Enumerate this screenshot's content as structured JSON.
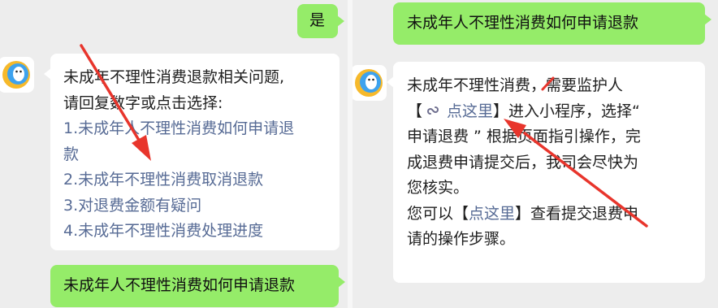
{
  "left_panel": {
    "top_user_bubble": "是",
    "bot_message": {
      "intro_line1": "未成年不理性消费退款相关问题,",
      "intro_line2": "请回复数字或点击选择:",
      "option1_line1": "1.未成年人不理性消费如何申请退",
      "option1_line2": "款",
      "option2": "2.未成年不理性消费取消退款",
      "option3": "3.对退费金额有疑问",
      "option4": "4.未成年不理性消费处理进度"
    },
    "bottom_user_bubble": "未成年人不理性消费如何申请退款"
  },
  "right_panel": {
    "top_user_bubble": "未成年人不理性消费如何申请退款",
    "bot_message": {
      "line1": "未成年不理性消费，需要监护人",
      "line2_open_bracket": "【",
      "line2_link": "点这里",
      "line2_rest": "】进入小程序，选择“",
      "line3": "申请退费 ” 根据页面指引操作，完",
      "line4": "成退费申请提交后，我司会尽快为",
      "line5": "您核实。",
      "line6_prefix": "您可以【",
      "line6_link": "点这里",
      "line6_suffix": "】查看提交退费申",
      "line7": "请的操作步骤。"
    }
  },
  "colors": {
    "user_bubble": "#95ec69",
    "bot_bubble": "#ffffff",
    "link": "#576b95",
    "annotation_arrow": "#e8352c",
    "background": "#ededed"
  },
  "icons": {
    "avatar": "qq-penguin-avatar",
    "mini_program": "mini-program-link-icon"
  }
}
